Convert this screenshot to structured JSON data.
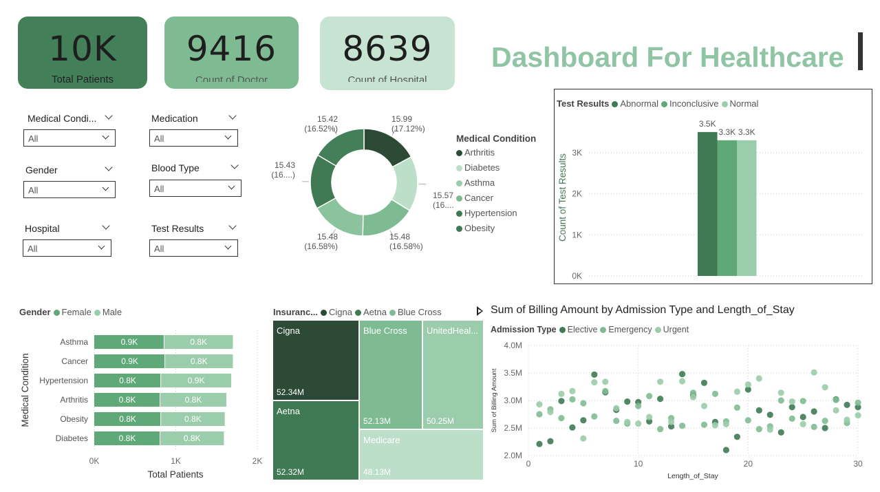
{
  "kpis": [
    {
      "value": "10K",
      "label": "Total Patients"
    },
    {
      "value": "9416",
      "label": "Count of Doctor"
    },
    {
      "value": "8639",
      "label": "Count of Hospital"
    }
  ],
  "title": "Dashboard For Healthcare",
  "slicers": [
    {
      "label": "Medical Condi...",
      "value": "All"
    },
    {
      "label": "Medication",
      "value": "All"
    },
    {
      "label": "Gender",
      "value": "All"
    },
    {
      "label": "Blood Type",
      "value": "All"
    },
    {
      "label": "Hospital",
      "value": "All"
    },
    {
      "label": "Test Results",
      "value": "All"
    }
  ],
  "colors": {
    "c1": "#2d4a36",
    "c2": "#3f7a54",
    "c3": "#5fa877",
    "c4": "#7fbb92",
    "c5": "#9bccab",
    "c6": "#bddfc9",
    "title": "#8fc4a4",
    "axis": "#666666"
  },
  "chart_data": [
    {
      "type": "pie",
      "legend_title": "Medical Condition",
      "categories": [
        "Arthritis",
        "Diabetes",
        "Asthma",
        "Cancer",
        "Hypertension",
        "Obesity"
      ],
      "slice_labels": [
        "15.99\n(17.12%)",
        "15.57\n(16....)",
        "15.48\n(16.58%)",
        "15.48\n(16.58%)",
        "15.43\n(16....)",
        "15.42\n(16.52%)"
      ],
      "values": [
        15.99,
        15.57,
        15.48,
        15.48,
        15.43,
        15.42
      ],
      "percents": [
        17.12,
        16.67,
        16.58,
        16.58,
        16.52,
        16.52
      ]
    },
    {
      "type": "bar",
      "legend_title": "Test Results",
      "categories": [
        "Abnormal",
        "Inconclusive",
        "Normal"
      ],
      "values": [
        3500,
        3300,
        3300
      ],
      "data_labels": [
        "3.5K",
        "3.3K",
        "3.3K"
      ],
      "ylabel": "Count of Test Results",
      "yticks": [
        "0K",
        "1K",
        "2K",
        "3K"
      ],
      "ylim": [
        0,
        4000
      ]
    },
    {
      "type": "bar",
      "orientation": "horizontal-stacked",
      "legend_title": "Gender",
      "categories": [
        "Asthma",
        "Cancer",
        "Hypertension",
        "Arthritis",
        "Obesity",
        "Diabetes"
      ],
      "series": [
        {
          "name": "Female",
          "values": [
            860,
            870,
            820,
            810,
            820,
            810
          ],
          "labels": [
            "0.9K",
            "0.9K",
            "0.8K",
            "0.8K",
            "0.8K",
            "0.8K"
          ]
        },
        {
          "name": "Male",
          "values": [
            840,
            830,
            860,
            810,
            780,
            780
          ],
          "labels": [
            "0.8K",
            "0.8K",
            "0.9K",
            "0.8K",
            "0.8K",
            "0.8K"
          ]
        }
      ],
      "xlabel": "Total Patients",
      "ylabel": "Medical Condition",
      "xticks": [
        "0K",
        "1K",
        "2K"
      ],
      "xlim": [
        0,
        2000
      ]
    },
    {
      "type": "treemap",
      "legend_title": "Insuranc...",
      "legend": [
        "Cigna",
        "Aetna",
        "Blue Cross"
      ],
      "cells": [
        {
          "name": "Cigna",
          "value": "52.34M"
        },
        {
          "name": "Aetna",
          "value": "52.32M"
        },
        {
          "name": "Blue Cross",
          "value": "52.13M"
        },
        {
          "name": "UnitedHeal...",
          "value": "50.25M"
        },
        {
          "name": "Medicare",
          "value": "48.13M"
        }
      ]
    },
    {
      "type": "scatter",
      "title": "Sum of Billing Amount by Admission Type and Length_of_Stay",
      "legend_title": "Admission Type",
      "xlabel": "Length_of_Stay",
      "ylabel": "Sum of Billing Amount",
      "xlim": [
        0,
        30
      ],
      "ylim": [
        2.0,
        4.0
      ],
      "xticks": [
        "0",
        "10",
        "20",
        "30"
      ],
      "yticks": [
        "2.0M",
        "2.5M",
        "3.0M",
        "3.5M",
        "4.0M"
      ],
      "series": [
        {
          "name": "Elective",
          "points": [
            [
              1,
              2.21
            ],
            [
              2,
              2.26
            ],
            [
              3,
              2.99
            ],
            [
              4,
              2.51
            ],
            [
              5,
              2.64
            ],
            [
              6,
              3.47
            ],
            [
              7,
              3.15
            ],
            [
              8,
              2.83
            ],
            [
              9,
              2.98
            ],
            [
              10,
              2.97
            ],
            [
              11,
              2.62
            ],
            [
              12,
              3.03
            ],
            [
              13,
              2.53
            ],
            [
              14,
              3.48
            ],
            [
              15,
              3.1
            ],
            [
              16,
              3.32
            ],
            [
              17,
              2.61
            ],
            [
              18,
              2.1
            ],
            [
              19,
              2.34
            ],
            [
              20,
              3.2
            ],
            [
              21,
              2.82
            ],
            [
              22,
              2.74
            ],
            [
              23,
              2.42
            ],
            [
              24,
              2.88
            ],
            [
              25,
              2.7
            ],
            [
              26,
              2.8
            ],
            [
              27,
              2.5
            ],
            [
              28,
              3.02
            ],
            [
              29,
              2.92
            ],
            [
              30,
              2.88
            ]
          ]
        },
        {
          "name": "Emergency",
          "points": [
            [
              1,
              2.75
            ],
            [
              2,
              2.84
            ],
            [
              3,
              2.68
            ],
            [
              4,
              3.02
            ],
            [
              5,
              2.95
            ],
            [
              6,
              2.71
            ],
            [
              7,
              3.17
            ],
            [
              8,
              2.63
            ],
            [
              9,
              2.58
            ],
            [
              10,
              2.9
            ],
            [
              11,
              3.08
            ],
            [
              12,
              2.48
            ],
            [
              13,
              2.68
            ],
            [
              14,
              2.54
            ],
            [
              15,
              3.14
            ],
            [
              16,
              2.56
            ],
            [
              17,
              3.12
            ],
            [
              18,
              2.62
            ],
            [
              19,
              2.87
            ],
            [
              20,
              2.64
            ],
            [
              21,
              2.48
            ],
            [
              22,
              2.53
            ],
            [
              23,
              3.0
            ],
            [
              24,
              2.67
            ],
            [
              25,
              2.99
            ],
            [
              26,
              2.52
            ],
            [
              27,
              2.63
            ],
            [
              28,
              3.01
            ],
            [
              29,
              2.59
            ],
            [
              30,
              2.96
            ]
          ]
        },
        {
          "name": "Urgent",
          "points": [
            [
              1,
              2.93
            ],
            [
              2,
              2.79
            ],
            [
              3,
              3.12
            ],
            [
              4,
              3.17
            ],
            [
              5,
              2.31
            ],
            [
              6,
              3.33
            ],
            [
              7,
              3.34
            ],
            [
              8,
              2.86
            ],
            [
              9,
              2.61
            ],
            [
              10,
              2.58
            ],
            [
              11,
              2.7
            ],
            [
              12,
              3.34
            ],
            [
              13,
              2.61
            ],
            [
              14,
              3.35
            ],
            [
              15,
              3.06
            ],
            [
              16,
              2.9
            ],
            [
              17,
              2.55
            ],
            [
              18,
              2.57
            ],
            [
              19,
              3.16
            ],
            [
              20,
              3.29
            ],
            [
              21,
              3.4
            ],
            [
              22,
              2.47
            ],
            [
              23,
              3.14
            ],
            [
              24,
              2.98
            ],
            [
              25,
              2.57
            ],
            [
              26,
              3.51
            ],
            [
              27,
              3.24
            ],
            [
              28,
              2.82
            ],
            [
              29,
              2.65
            ],
            [
              30,
              2.73
            ]
          ]
        }
      ]
    }
  ]
}
